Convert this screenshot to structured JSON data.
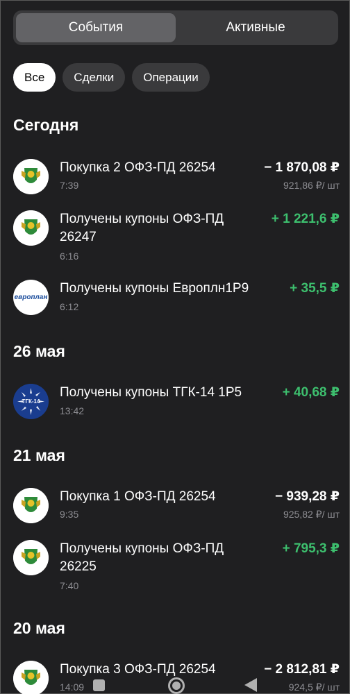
{
  "tabs": [
    {
      "label": "События",
      "active": true
    },
    {
      "label": "Активные",
      "active": false
    }
  ],
  "filters": [
    {
      "label": "Все",
      "active": true
    },
    {
      "label": "Сделки",
      "active": false
    },
    {
      "label": "Операции",
      "active": false
    }
  ],
  "sections": [
    {
      "title": "Сегодня",
      "items": [
        {
          "icon": "ofz-emblem-icon",
          "title": "Покупка 2 ОФЗ-ПД 26254",
          "time": "7:39",
          "amount": "− 1 870,08 ₽",
          "price": "921,86 ₽/ шт"
        },
        {
          "icon": "ofz-emblem-icon",
          "title": "Получены купоны ОФЗ-ПД 26247",
          "time": "6:16",
          "amount": "+ 1 221,6 ₽",
          "price": ""
        },
        {
          "icon": "evroplan-logo-icon",
          "logo_text": "европлан",
          "title": "Получены купоны Европлн1Р9",
          "time": "6:12",
          "amount": "+ 35,5 ₽",
          "price": ""
        }
      ]
    },
    {
      "title": "26 мая",
      "items": [
        {
          "icon": "tgk14-logo-icon",
          "logo_text": "ТГК-14",
          "title": "Получены купоны ТГК-14 1Р5",
          "time": "13:42",
          "amount": "+ 40,68 ₽",
          "price": ""
        }
      ]
    },
    {
      "title": "21 мая",
      "items": [
        {
          "icon": "ofz-emblem-icon",
          "title": "Покупка 1 ОФЗ-ПД 26254",
          "time": "9:35",
          "amount": "− 939,28 ₽",
          "price": "925,82 ₽/ шт"
        },
        {
          "icon": "ofz-emblem-icon",
          "title": "Получены купоны ОФЗ-ПД 26225",
          "time": "7:40",
          "amount": "+ 795,3 ₽",
          "price": ""
        }
      ]
    },
    {
      "title": "20 мая",
      "items": [
        {
          "icon": "ofz-emblem-icon",
          "title": "Покупка 3 ОФЗ-ПД 26254",
          "time": "14:09",
          "amount": "− 2 812,81 ₽",
          "price": "924,5 ₽/ шт"
        }
      ]
    }
  ],
  "colors": {
    "positive": "#3dbf6e",
    "negative": "#ffffff",
    "background": "#1f1f21"
  },
  "navbar": [
    "recent-apps-icon",
    "home-icon",
    "back-icon"
  ]
}
